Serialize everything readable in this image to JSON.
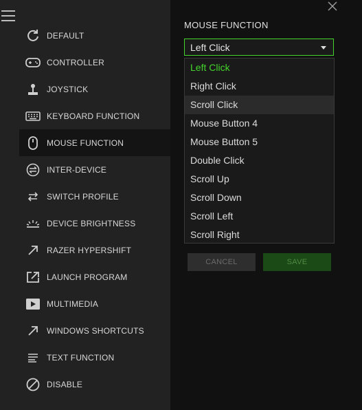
{
  "sidebar": {
    "items": [
      {
        "label": "DEFAULT",
        "icon": "refresh-icon"
      },
      {
        "label": "CONTROLLER",
        "icon": "gamepad-icon"
      },
      {
        "label": "JOYSTICK",
        "icon": "joystick-icon"
      },
      {
        "label": "KEYBOARD FUNCTION",
        "icon": "keyboard-icon"
      },
      {
        "label": "MOUSE FUNCTION",
        "icon": "mouse-icon",
        "active": true
      },
      {
        "label": "INTER-DEVICE",
        "icon": "inter-device-icon"
      },
      {
        "label": "SWITCH PROFILE",
        "icon": "switch-arrows-icon"
      },
      {
        "label": "DEVICE BRIGHTNESS",
        "icon": "brightness-icon"
      },
      {
        "label": "RAZER HYPERSHIFT",
        "icon": "hypershift-arrow-icon"
      },
      {
        "label": "LAUNCH PROGRAM",
        "icon": "launch-icon"
      },
      {
        "label": "MULTIMEDIA",
        "icon": "play-icon"
      },
      {
        "label": "WINDOWS SHORTCUTS",
        "icon": "shortcut-arrow-icon"
      },
      {
        "label": "TEXT FUNCTION",
        "icon": "text-lines-icon"
      },
      {
        "label": "DISABLE",
        "icon": "disable-icon"
      }
    ]
  },
  "main": {
    "title": "MOUSE FUNCTION",
    "select": {
      "value": "Left Click",
      "options": [
        "Left Click",
        "Right Click",
        "Scroll Click",
        "Mouse Button 4",
        "Mouse Button 5",
        "Double Click",
        "Scroll Up",
        "Scroll Down",
        "Scroll Left",
        "Scroll Right"
      ],
      "highlighted": "Scroll Click"
    },
    "buttons": {
      "cancel": "CANCEL",
      "save": "SAVE"
    }
  },
  "colors": {
    "accent": "#44d62c",
    "sidebar_bg": "#222222",
    "main_bg": "#111111"
  }
}
